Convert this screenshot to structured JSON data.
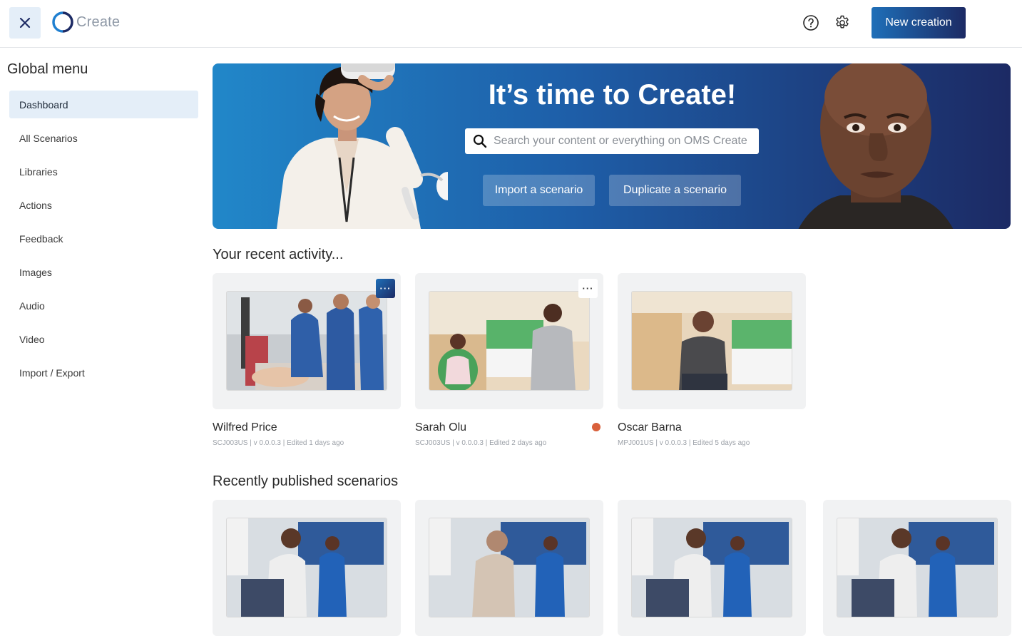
{
  "app": {
    "name": "Create"
  },
  "toolbar": {
    "new_creation_label": "New creation"
  },
  "sidebar": {
    "title": "Global menu",
    "items": [
      {
        "label": "Dashboard",
        "active": true
      },
      {
        "label": "All Scenarios"
      },
      {
        "label": "Libraries"
      },
      {
        "label": "Actions"
      },
      {
        "label": "Feedback"
      },
      {
        "label": "Images"
      },
      {
        "label": "Audio"
      },
      {
        "label": "Video"
      },
      {
        "label": "Import / Export"
      }
    ]
  },
  "hero": {
    "title": "It’s time to Create!",
    "search_placeholder": "Search your content or everything on OMS Create",
    "import_label": "Import a scenario",
    "duplicate_label": "Duplicate a scenario"
  },
  "recent": {
    "title": "Your recent activity...",
    "cards": [
      {
        "name": "Wilfred Price",
        "meta": "SCJ003US  |  v 0.0.0.3  |   Edited 1 days ago"
      },
      {
        "name": "Sarah Olu",
        "meta": "SCJ003US  |  v 0.0.0.3  |   Edited 2 days ago",
        "status_color": "#d9603b"
      },
      {
        "name": "Oscar Barna",
        "meta": "MPJ001US  |  v 0.0.0.3  |   Edited 5 days ago"
      }
    ]
  },
  "published": {
    "title": "Recently published scenarios"
  },
  "colors": {
    "accent": "#1f6fb8",
    "accent_dark": "#1c2a64",
    "active_bg": "#e4eef8",
    "status_dot": "#d9603b"
  },
  "icons": [
    "close-icon",
    "logo-icon",
    "help-icon",
    "gear-icon",
    "search-icon",
    "more-icon"
  ]
}
